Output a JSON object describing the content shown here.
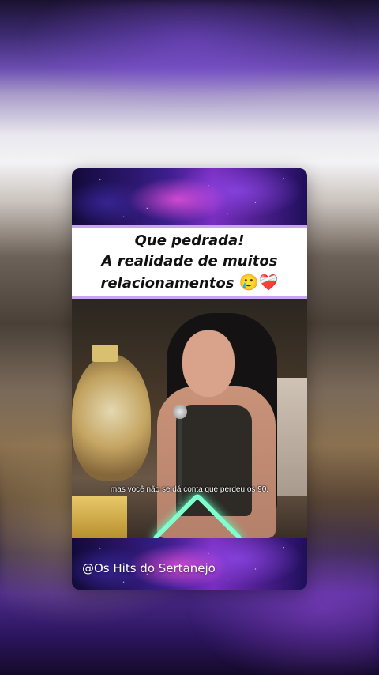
{
  "caption": {
    "line1": "Que pedrada!",
    "line2": "A realidade de muitos",
    "line3": "relacionamentos",
    "line3_emoji": "🥲❤️‍🩹"
  },
  "video": {
    "subtitle": "mas você não se dá conta que perdeu os 90."
  },
  "watermark": "@Os Hits do Sertanejo"
}
